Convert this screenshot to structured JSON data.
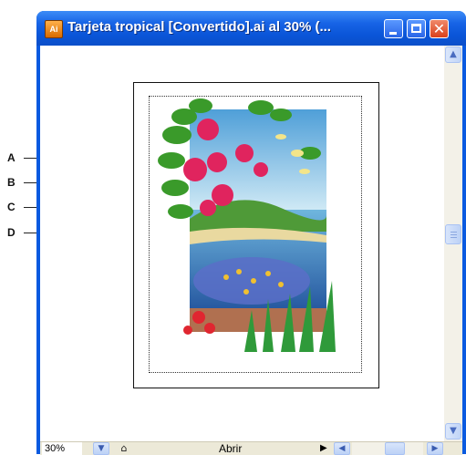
{
  "window": {
    "title": "Tarjeta tropical [Convertido].ai al 30% (...",
    "app_icon_text": "Ai",
    "controls": {
      "minimize": "minimize",
      "maximize": "maximize",
      "close": "✕"
    },
    "titlebar_color": "#0a55d8"
  },
  "callouts": [
    {
      "label": "A"
    },
    {
      "label": "B"
    },
    {
      "label": "C"
    },
    {
      "label": "D"
    }
  ],
  "statusbar": {
    "zoom": "30%",
    "status_text": "Abrir",
    "arrow": "▶"
  },
  "scrollbar": {
    "up": "▲",
    "down": "▼",
    "left": "◀",
    "right": "▶"
  },
  "colors": {
    "accent": "#0a55d8",
    "close": "#d8401c",
    "sky": "#7ec4e6",
    "leaf": "#3a9a2a",
    "flower": "#e0245e",
    "water": "#2f6fb8"
  }
}
